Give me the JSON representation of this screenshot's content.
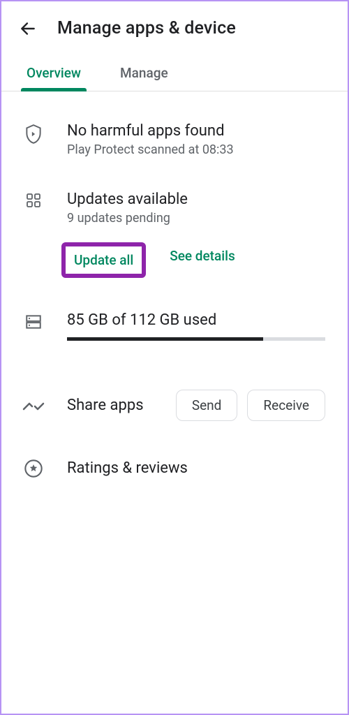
{
  "header": {
    "title": "Manage apps & device"
  },
  "tabs": {
    "overview": "Overview",
    "manage": "Manage"
  },
  "protect": {
    "title": "No harmful apps found",
    "subtitle": "Play Protect scanned at 08:33"
  },
  "updates": {
    "title": "Updates available",
    "subtitle": "9 updates pending",
    "update_all": "Update all",
    "see_details": "See details"
  },
  "storage": {
    "text": "85 GB of 112 GB used",
    "percent": 76
  },
  "share": {
    "label": "Share apps",
    "send": "Send",
    "receive": "Receive"
  },
  "ratings": {
    "label": "Ratings & reviews"
  }
}
